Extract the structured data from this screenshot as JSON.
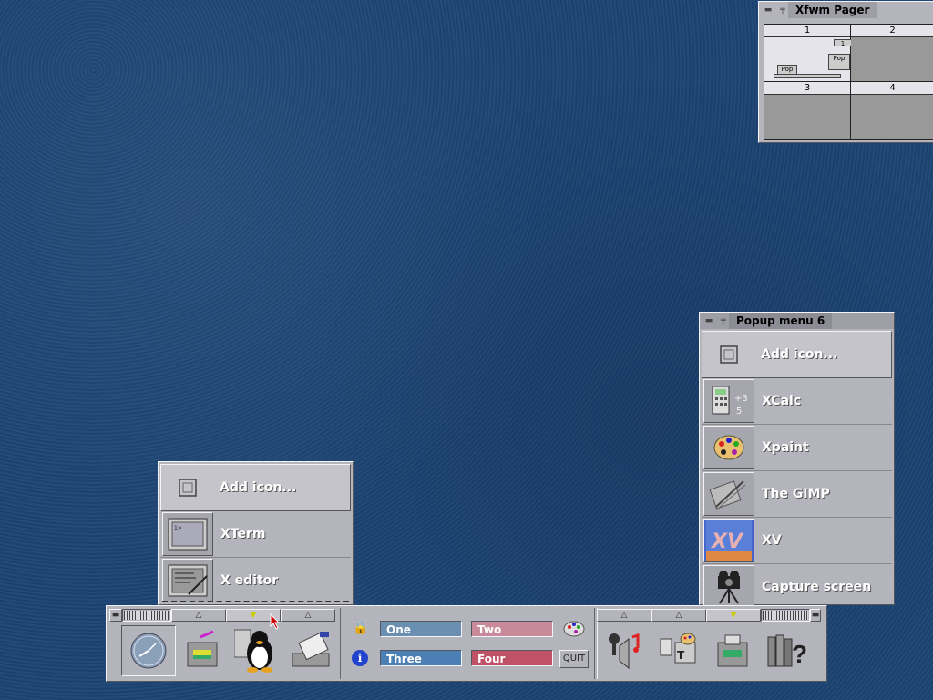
{
  "pager": {
    "title": "Xfwm Pager",
    "desks": [
      "1",
      "2",
      "3",
      "4"
    ],
    "mini_labels": [
      "Pop",
      "Pop",
      "1"
    ]
  },
  "popup6": {
    "title": "Popup menu 6",
    "items": [
      {
        "label": "Add icon...",
        "icon": "frame-icon"
      },
      {
        "label": "XCalc",
        "icon": "calculator-icon"
      },
      {
        "label": "Xpaint",
        "icon": "palette-icon"
      },
      {
        "label": "The GIMP",
        "icon": "gimp-icon"
      },
      {
        "label": "XV",
        "icon": "xv-icon"
      },
      {
        "label": "Capture screen",
        "icon": "camera-icon"
      }
    ]
  },
  "popup_left": {
    "items": [
      {
        "label": "Add icon...",
        "icon": "frame-icon"
      },
      {
        "label": "XTerm",
        "icon": "terminal-icon"
      },
      {
        "label": "X editor",
        "icon": "editor-icon"
      }
    ]
  },
  "panel": {
    "workspaces": [
      "One",
      "Two",
      "Three",
      "Four"
    ],
    "quit_label": "QUIT",
    "colors": {
      "one": "#6a8fb0",
      "two": "#c88a9a",
      "three": "#4c7fb4",
      "four": "#c05268"
    }
  }
}
